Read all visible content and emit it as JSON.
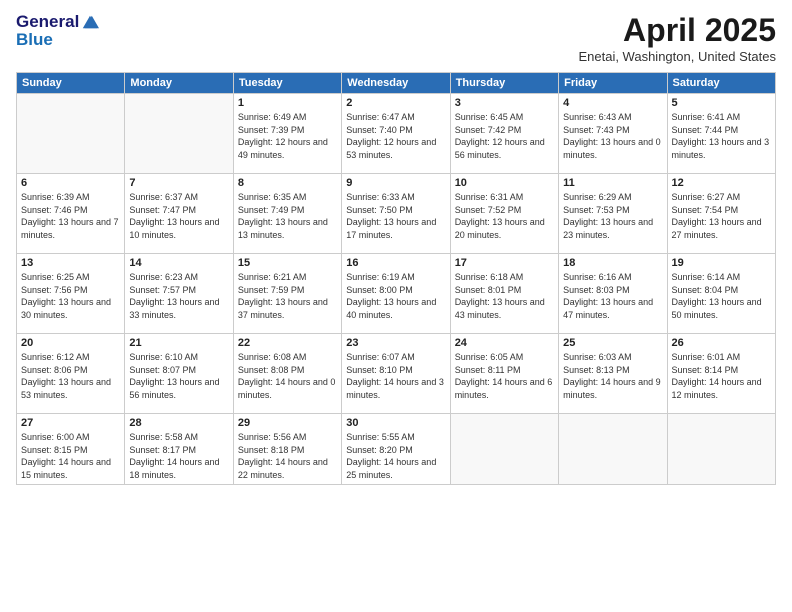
{
  "header": {
    "logo_general": "General",
    "logo_blue": "Blue",
    "main_title": "April 2025",
    "subtitle": "Enetai, Washington, United States"
  },
  "days_of_week": [
    "Sunday",
    "Monday",
    "Tuesday",
    "Wednesday",
    "Thursday",
    "Friday",
    "Saturday"
  ],
  "weeks": [
    [
      {
        "day": "",
        "sunrise": "",
        "sunset": "",
        "daylight": ""
      },
      {
        "day": "",
        "sunrise": "",
        "sunset": "",
        "daylight": ""
      },
      {
        "day": "1",
        "sunrise": "Sunrise: 6:49 AM",
        "sunset": "Sunset: 7:39 PM",
        "daylight": "Daylight: 12 hours and 49 minutes."
      },
      {
        "day": "2",
        "sunrise": "Sunrise: 6:47 AM",
        "sunset": "Sunset: 7:40 PM",
        "daylight": "Daylight: 12 hours and 53 minutes."
      },
      {
        "day": "3",
        "sunrise": "Sunrise: 6:45 AM",
        "sunset": "Sunset: 7:42 PM",
        "daylight": "Daylight: 12 hours and 56 minutes."
      },
      {
        "day": "4",
        "sunrise": "Sunrise: 6:43 AM",
        "sunset": "Sunset: 7:43 PM",
        "daylight": "Daylight: 13 hours and 0 minutes."
      },
      {
        "day": "5",
        "sunrise": "Sunrise: 6:41 AM",
        "sunset": "Sunset: 7:44 PM",
        "daylight": "Daylight: 13 hours and 3 minutes."
      }
    ],
    [
      {
        "day": "6",
        "sunrise": "Sunrise: 6:39 AM",
        "sunset": "Sunset: 7:46 PM",
        "daylight": "Daylight: 13 hours and 7 minutes."
      },
      {
        "day": "7",
        "sunrise": "Sunrise: 6:37 AM",
        "sunset": "Sunset: 7:47 PM",
        "daylight": "Daylight: 13 hours and 10 minutes."
      },
      {
        "day": "8",
        "sunrise": "Sunrise: 6:35 AM",
        "sunset": "Sunset: 7:49 PM",
        "daylight": "Daylight: 13 hours and 13 minutes."
      },
      {
        "day": "9",
        "sunrise": "Sunrise: 6:33 AM",
        "sunset": "Sunset: 7:50 PM",
        "daylight": "Daylight: 13 hours and 17 minutes."
      },
      {
        "day": "10",
        "sunrise": "Sunrise: 6:31 AM",
        "sunset": "Sunset: 7:52 PM",
        "daylight": "Daylight: 13 hours and 20 minutes."
      },
      {
        "day": "11",
        "sunrise": "Sunrise: 6:29 AM",
        "sunset": "Sunset: 7:53 PM",
        "daylight": "Daylight: 13 hours and 23 minutes."
      },
      {
        "day": "12",
        "sunrise": "Sunrise: 6:27 AM",
        "sunset": "Sunset: 7:54 PM",
        "daylight": "Daylight: 13 hours and 27 minutes."
      }
    ],
    [
      {
        "day": "13",
        "sunrise": "Sunrise: 6:25 AM",
        "sunset": "Sunset: 7:56 PM",
        "daylight": "Daylight: 13 hours and 30 minutes."
      },
      {
        "day": "14",
        "sunrise": "Sunrise: 6:23 AM",
        "sunset": "Sunset: 7:57 PM",
        "daylight": "Daylight: 13 hours and 33 minutes."
      },
      {
        "day": "15",
        "sunrise": "Sunrise: 6:21 AM",
        "sunset": "Sunset: 7:59 PM",
        "daylight": "Daylight: 13 hours and 37 minutes."
      },
      {
        "day": "16",
        "sunrise": "Sunrise: 6:19 AM",
        "sunset": "Sunset: 8:00 PM",
        "daylight": "Daylight: 13 hours and 40 minutes."
      },
      {
        "day": "17",
        "sunrise": "Sunrise: 6:18 AM",
        "sunset": "Sunset: 8:01 PM",
        "daylight": "Daylight: 13 hours and 43 minutes."
      },
      {
        "day": "18",
        "sunrise": "Sunrise: 6:16 AM",
        "sunset": "Sunset: 8:03 PM",
        "daylight": "Daylight: 13 hours and 47 minutes."
      },
      {
        "day": "19",
        "sunrise": "Sunrise: 6:14 AM",
        "sunset": "Sunset: 8:04 PM",
        "daylight": "Daylight: 13 hours and 50 minutes."
      }
    ],
    [
      {
        "day": "20",
        "sunrise": "Sunrise: 6:12 AM",
        "sunset": "Sunset: 8:06 PM",
        "daylight": "Daylight: 13 hours and 53 minutes."
      },
      {
        "day": "21",
        "sunrise": "Sunrise: 6:10 AM",
        "sunset": "Sunset: 8:07 PM",
        "daylight": "Daylight: 13 hours and 56 minutes."
      },
      {
        "day": "22",
        "sunrise": "Sunrise: 6:08 AM",
        "sunset": "Sunset: 8:08 PM",
        "daylight": "Daylight: 14 hours and 0 minutes."
      },
      {
        "day": "23",
        "sunrise": "Sunrise: 6:07 AM",
        "sunset": "Sunset: 8:10 PM",
        "daylight": "Daylight: 14 hours and 3 minutes."
      },
      {
        "day": "24",
        "sunrise": "Sunrise: 6:05 AM",
        "sunset": "Sunset: 8:11 PM",
        "daylight": "Daylight: 14 hours and 6 minutes."
      },
      {
        "day": "25",
        "sunrise": "Sunrise: 6:03 AM",
        "sunset": "Sunset: 8:13 PM",
        "daylight": "Daylight: 14 hours and 9 minutes."
      },
      {
        "day": "26",
        "sunrise": "Sunrise: 6:01 AM",
        "sunset": "Sunset: 8:14 PM",
        "daylight": "Daylight: 14 hours and 12 minutes."
      }
    ],
    [
      {
        "day": "27",
        "sunrise": "Sunrise: 6:00 AM",
        "sunset": "Sunset: 8:15 PM",
        "daylight": "Daylight: 14 hours and 15 minutes."
      },
      {
        "day": "28",
        "sunrise": "Sunrise: 5:58 AM",
        "sunset": "Sunset: 8:17 PM",
        "daylight": "Daylight: 14 hours and 18 minutes."
      },
      {
        "day": "29",
        "sunrise": "Sunrise: 5:56 AM",
        "sunset": "Sunset: 8:18 PM",
        "daylight": "Daylight: 14 hours and 22 minutes."
      },
      {
        "day": "30",
        "sunrise": "Sunrise: 5:55 AM",
        "sunset": "Sunset: 8:20 PM",
        "daylight": "Daylight: 14 hours and 25 minutes."
      },
      {
        "day": "",
        "sunrise": "",
        "sunset": "",
        "daylight": ""
      },
      {
        "day": "",
        "sunrise": "",
        "sunset": "",
        "daylight": ""
      },
      {
        "day": "",
        "sunrise": "",
        "sunset": "",
        "daylight": ""
      }
    ]
  ]
}
